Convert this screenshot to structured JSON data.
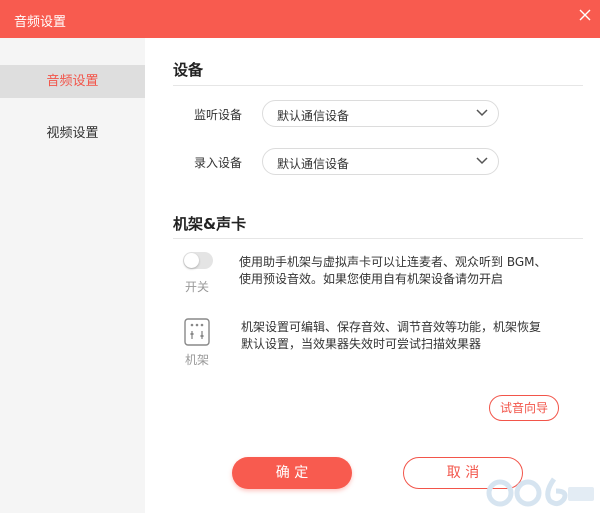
{
  "window": {
    "title": "音频设置"
  },
  "sidebar": {
    "items": [
      {
        "label": "音频设置",
        "active": true
      },
      {
        "label": "视频设置",
        "active": false
      }
    ]
  },
  "devices": {
    "heading": "设备",
    "monitor": {
      "label": "监听设备",
      "value": "默认通信设备"
    },
    "record": {
      "label": "录入设备",
      "value": "默认通信设备"
    }
  },
  "rack": {
    "heading": "机架&声卡",
    "switch": {
      "caption": "开关",
      "on": false,
      "description_line1": "使用助手机架与虚拟声卡可以让连麦者、观众听到 BGM、",
      "description_line2": "使用预设音效。如果您使用自有机架设备请勿开启"
    },
    "rack_item": {
      "caption": "机架",
      "description_line1": "机架设置可编辑、保存音效、调节音效等功能，机架恢复",
      "description_line2": "默认设置，当效果器失效时可尝试扫描效果器"
    },
    "test_button": "试音向导"
  },
  "footer": {
    "confirm": "确 定",
    "cancel": "取 消"
  },
  "colors": {
    "accent": "#f85b4f",
    "accent_text": "#f2554a",
    "sidebar_bg": "#f5f5f5"
  }
}
